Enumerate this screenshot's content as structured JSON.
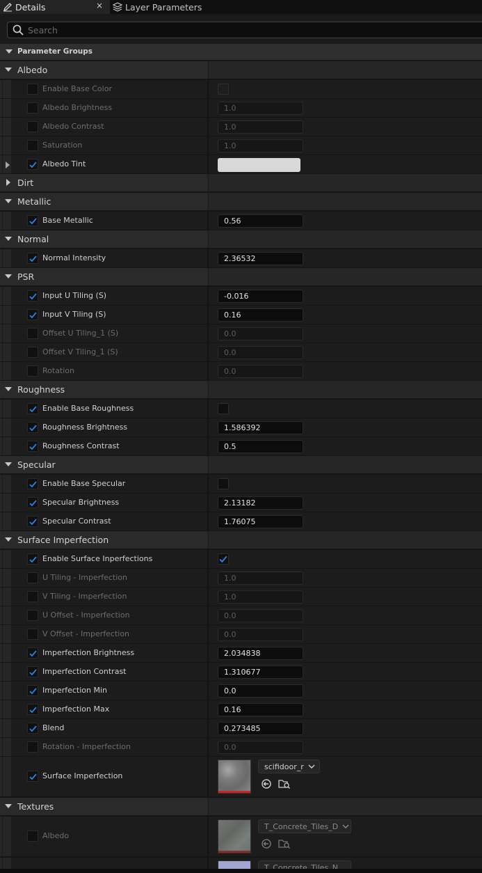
{
  "tabs": {
    "details": "Details",
    "layer_parameters": "Layer Parameters",
    "close_glyph": "×"
  },
  "search": {
    "placeholder": "Search"
  },
  "header": {
    "title": "Parameter Groups"
  },
  "groups": {
    "albedo": {
      "label": "Albedo",
      "enable_base_color": "Enable Base Color",
      "albedo_brightness": {
        "label": "Albedo Brightness",
        "value": "1.0"
      },
      "albedo_contrast": {
        "label": "Albedo Contrast",
        "value": "1.0"
      },
      "saturation": {
        "label": "Saturation",
        "value": "1.0"
      },
      "albedo_tint": {
        "label": "Albedo Tint",
        "color": "#d8d8d8"
      }
    },
    "dirt": {
      "label": "Dirt"
    },
    "metallic": {
      "label": "Metallic",
      "base_metallic": {
        "label": "Base Metallic",
        "value": "0.56"
      }
    },
    "normal": {
      "label": "Normal",
      "normal_intensity": {
        "label": "Normal Intensity",
        "value": "2.36532"
      }
    },
    "psr": {
      "label": "PSR",
      "input_u": {
        "label": "Input U Tiling (S)",
        "value": "-0.016"
      },
      "input_v": {
        "label": "Input V Tiling (S)",
        "value": "0.16"
      },
      "offset_u": {
        "label": "Offset U Tiling_1 (S)",
        "value": "0.0"
      },
      "offset_v": {
        "label": "Offset V Tiling_1 (S)",
        "value": "0.0"
      },
      "rotation": {
        "label": "Rotation",
        "value": "0.0"
      }
    },
    "roughness": {
      "label": "Roughness",
      "enable_base": "Enable Base Roughness",
      "brightness": {
        "label": "Roughness Brightness",
        "value": "1.586392"
      },
      "contrast": {
        "label": "Roughness Contrast",
        "value": "0.5"
      }
    },
    "specular": {
      "label": "Specular",
      "enable_base": "Enable Base Specular",
      "brightness": {
        "label": "Specular Brightness",
        "value": "2.13182"
      },
      "contrast": {
        "label": "Specular Contrast",
        "value": "1.76075"
      }
    },
    "surface_imperfection": {
      "label": "Surface Imperfection",
      "enable": "Enable Surface Inperfections",
      "u_tiling": {
        "label": "U Tiling - Imperfection",
        "value": "1.0"
      },
      "v_tiling": {
        "label": "V Tiling - Imperfection",
        "value": "1.0"
      },
      "u_offset": {
        "label": "U Offset - Imperfection",
        "value": "0.0"
      },
      "v_offset": {
        "label": "V Offset - Imperfection",
        "value": "0.0"
      },
      "brightness": {
        "label": "Imperfection Brightness",
        "value": "2.034838"
      },
      "contrast": {
        "label": "Imperfection Contrast",
        "value": "1.310677"
      },
      "min": {
        "label": "Imperfection Min",
        "value": "0.0"
      },
      "max": {
        "label": "Imperfection Max",
        "value": "0.16"
      },
      "blend": {
        "label": "Blend",
        "value": "0.273485"
      },
      "rotation": {
        "label": "Rotation - Imperfection",
        "value": "0.0"
      },
      "texture": {
        "label": "Surface Imperfection",
        "asset": "scifidoor_r"
      }
    },
    "textures": {
      "label": "Textures",
      "albedo": {
        "label": "Albedo",
        "asset": "T_Concrete_Tiles_D"
      },
      "normal_asset": "T_Concrete_Tiles_N"
    }
  },
  "colors": {
    "accent": "#2f7fe0",
    "tint": "#d8d8d8"
  }
}
